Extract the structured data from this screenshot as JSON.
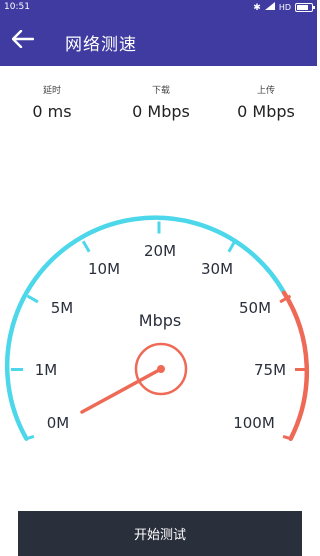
{
  "status_bar": {
    "time": "10:51",
    "network": "HD"
  },
  "app_bar": {
    "title": "网络测速",
    "back_icon": "back-arrow-icon"
  },
  "stats": [
    {
      "label": "延时",
      "value": "0 ms"
    },
    {
      "label": "下载",
      "value": "0 Mbps"
    },
    {
      "label": "上传",
      "value": "0 Mbps"
    }
  ],
  "gauge": {
    "unit": "Mbps",
    "labels": [
      "0M",
      "1M",
      "5M",
      "10M",
      "20M",
      "30M",
      "50M",
      "75M",
      "100M"
    ],
    "needle_value": "0M",
    "colors": {
      "low_arc": "#4dd7ea",
      "high_arc": "#ee6a57",
      "text": "#2a2f3c"
    }
  },
  "actions": {
    "start_label": "开始测试"
  }
}
